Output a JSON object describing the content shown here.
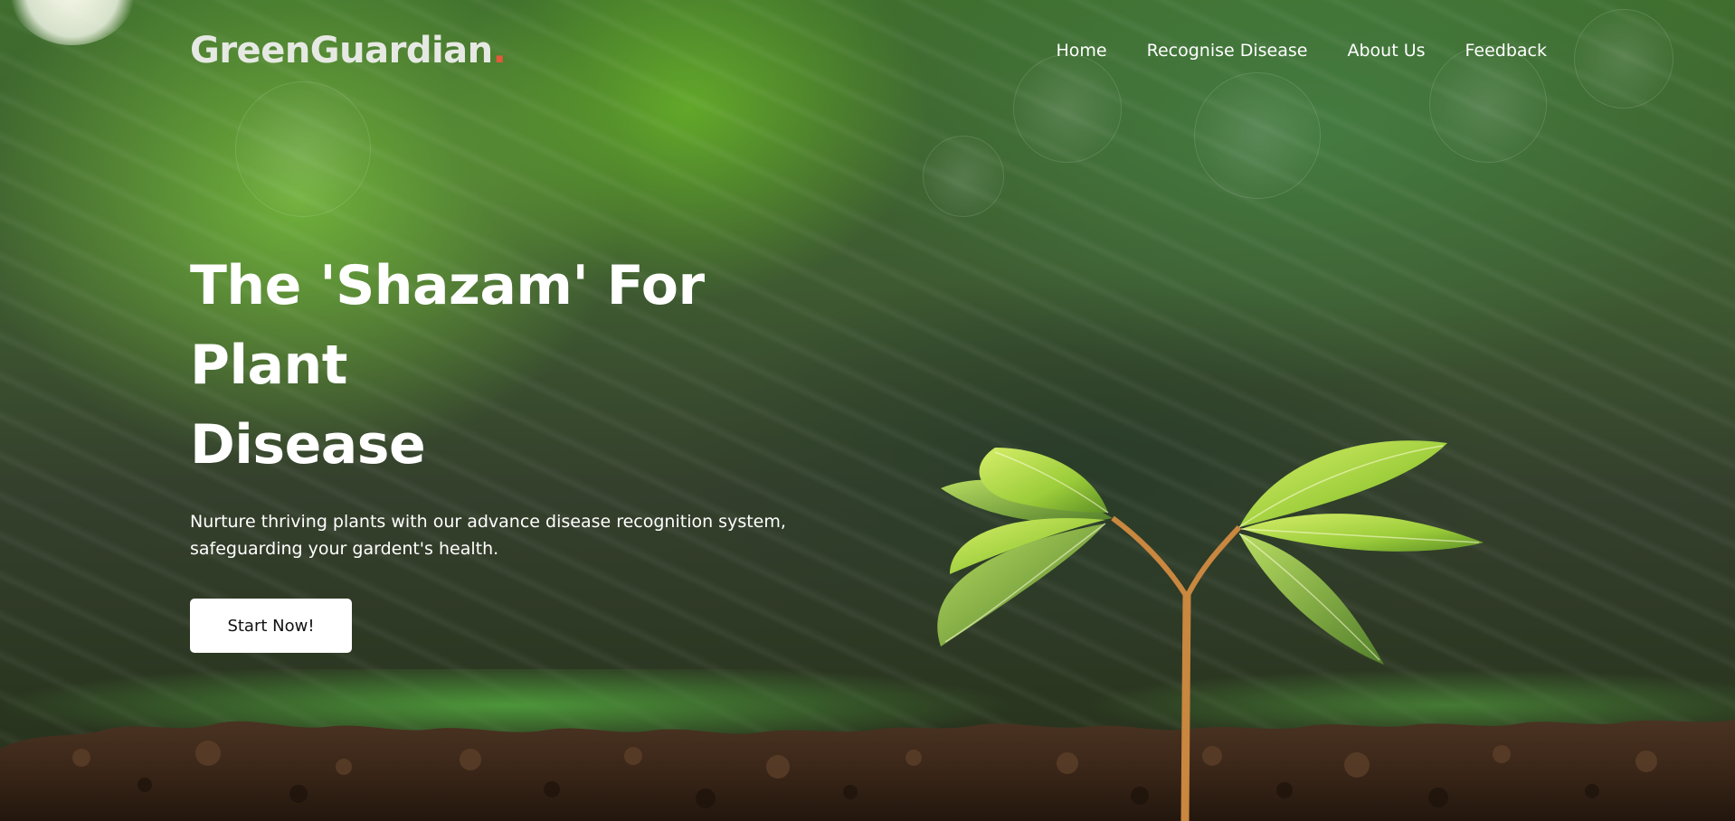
{
  "brand": {
    "name": "GreenGuardian",
    "dot": ".",
    "dot_color": "#e25a3b"
  },
  "nav": {
    "items": [
      {
        "label": "Home"
      },
      {
        "label": "Recognise Disease"
      },
      {
        "label": "About Us"
      },
      {
        "label": "Feedback"
      }
    ]
  },
  "hero": {
    "title_line1": "The 'Shazam' For Plant",
    "title_line2": "Disease",
    "subtitle_line1": "Nurture thriving plants with our advance disease recognition system,",
    "subtitle_line2": "safeguarding your gardent's health.",
    "cta_label": "Start Now!"
  },
  "background": {
    "image": "sprout-in-soil-photo",
    "accent_green": "#6fb83a",
    "soil_brown": "#3a2618"
  }
}
